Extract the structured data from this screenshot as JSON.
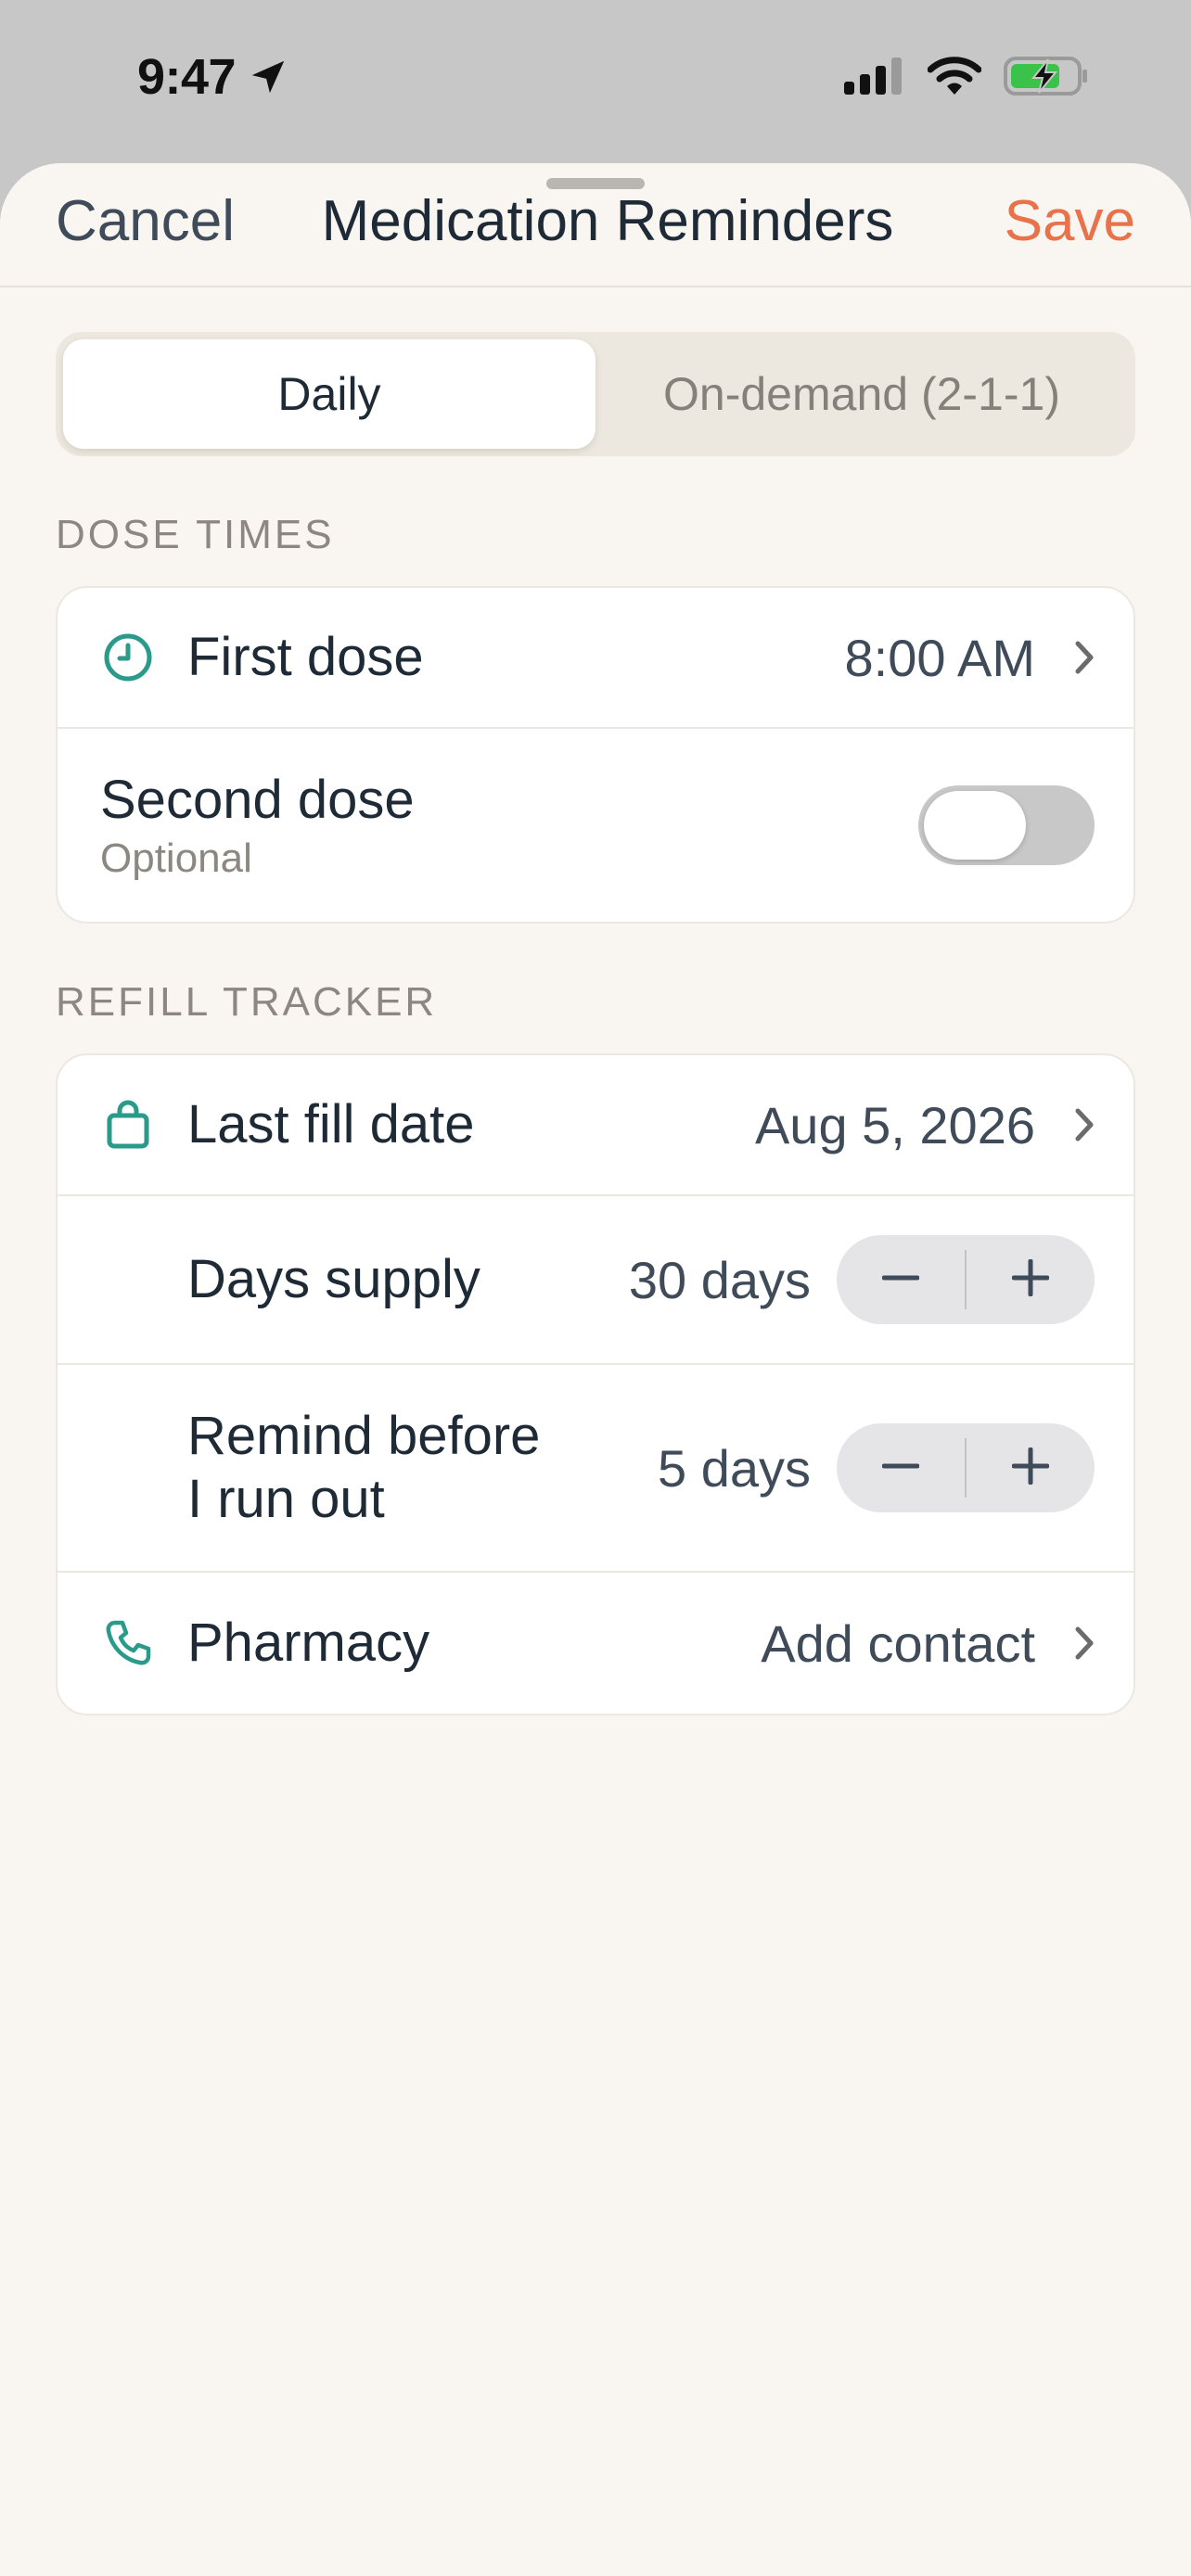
{
  "status_bar": {
    "time": "9:47"
  },
  "header": {
    "cancel": "Cancel",
    "title": "Medication Reminders",
    "save": "Save"
  },
  "segmented": {
    "options": [
      "Daily",
      "On-demand (2-1-1)"
    ],
    "selected": "Daily"
  },
  "dose_times": {
    "label": "DOSE TIMES",
    "first_dose": {
      "label": "First dose",
      "value": "8:00 AM"
    },
    "second_dose": {
      "label": "Second dose",
      "sublabel": "Optional",
      "enabled": false
    }
  },
  "refill_tracker": {
    "label": "REFILL TRACKER",
    "last_fill": {
      "label": "Last fill date",
      "value": "Aug 5, 2026"
    },
    "days_supply": {
      "label": "Days supply",
      "value": "30 days"
    },
    "remind_before": {
      "label_line1": "Remind before",
      "label_line2": "I run out",
      "value": "5 days"
    },
    "pharmacy": {
      "label": "Pharmacy",
      "value": "Add contact"
    }
  },
  "colors": {
    "accent": "#e8734a",
    "icon": "#2a9a8a",
    "background": "#f9f6f2"
  },
  "icons": [
    "location-arrow-icon",
    "signal-icon",
    "wifi-icon",
    "battery-charging-icon",
    "clock-icon",
    "bag-icon",
    "phone-icon",
    "chevron-right-icon",
    "minus-icon",
    "plus-icon"
  ]
}
